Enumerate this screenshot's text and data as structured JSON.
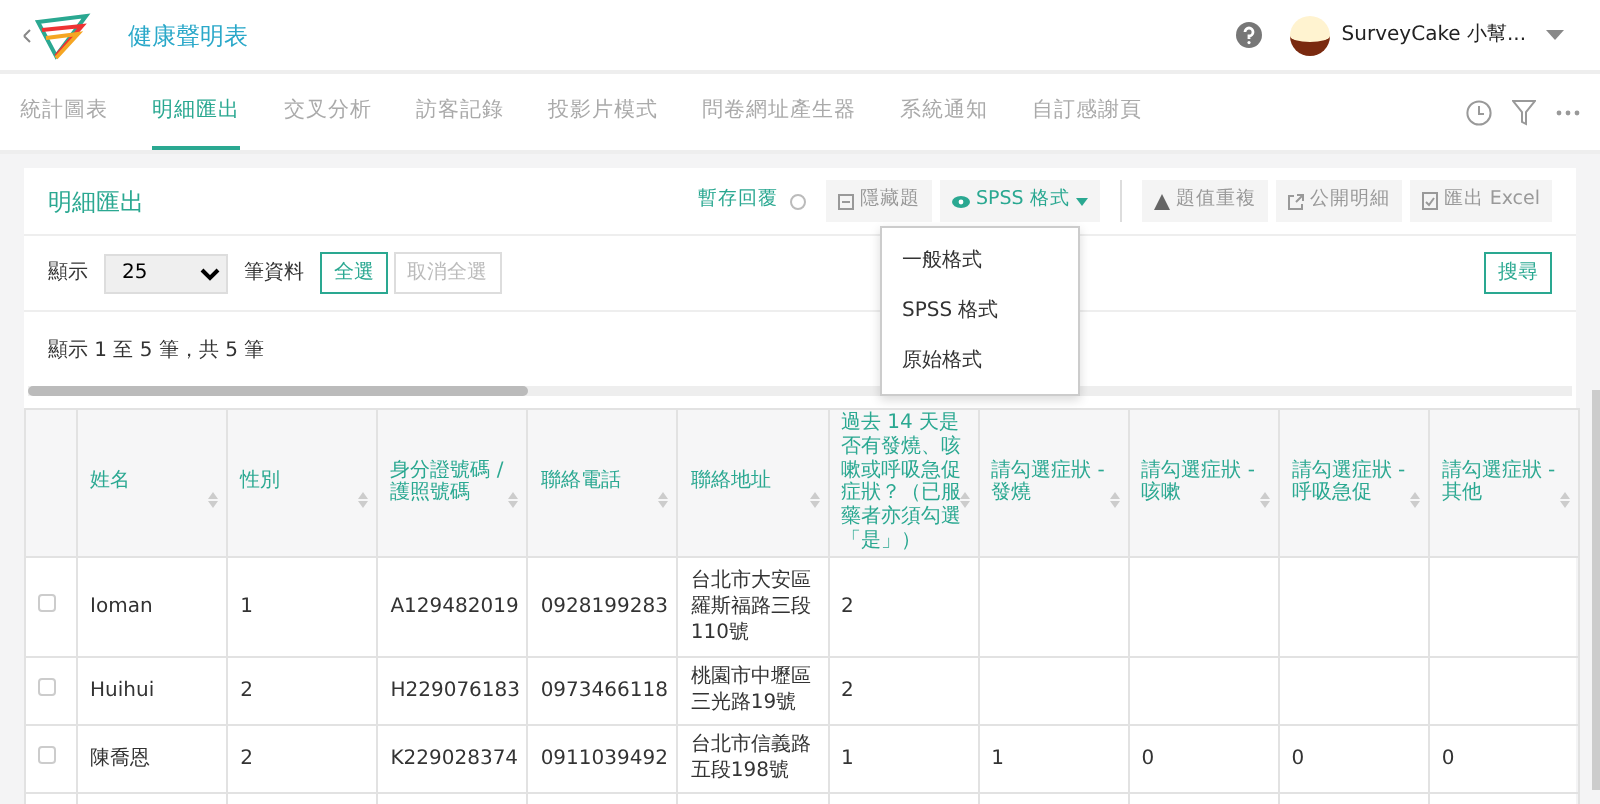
{
  "header": {
    "title": "健康聲明表",
    "user": "SurveyCake 小幫..."
  },
  "tabs": [
    {
      "label": "統計圖表",
      "selected": false
    },
    {
      "label": "明細匯出",
      "selected": true
    },
    {
      "label": "交叉分析",
      "selected": false
    },
    {
      "label": "訪客記錄",
      "selected": false
    },
    {
      "label": "投影片模式",
      "selected": false
    },
    {
      "label": "問卷網址產生器",
      "selected": false
    },
    {
      "label": "系統通知",
      "selected": false
    },
    {
      "label": "自訂感謝頁",
      "selected": false
    }
  ],
  "panel": {
    "title": "明細匯出",
    "save_draft": "暫存回覆",
    "toolbar": [
      {
        "label": "隱藏題",
        "kind": "hide",
        "expanded": false
      },
      {
        "label": "SPSS 格式",
        "kind": "format",
        "expanded": true
      },
      {
        "label": "題值重複",
        "kind": "warn",
        "expanded": false
      },
      {
        "label": "公開明細",
        "kind": "share",
        "expanded": false
      },
      {
        "label": "匯出 Excel",
        "kind": "export",
        "expanded": false
      }
    ],
    "format_menu": [
      "一般格式",
      "SPSS 格式",
      "原始格式"
    ],
    "show_label": "顯示",
    "page_size": "25",
    "page_size_suffix": "筆資料",
    "select_buttons": [
      {
        "label": "全選",
        "disabled": false
      },
      {
        "label": "取消全選",
        "disabled": true
      }
    ],
    "search_button": "搜尋",
    "info": "顯示 1 至 5 筆，共 5 筆",
    "table": {
      "columns": [
        "姓名",
        "性別",
        "身分證號碼 / 護照號碼",
        "聯絡電話",
        "聯絡地址",
        "過去 14 天是否有發燒、咳嗽或呼吸急促症狀？（已服藥者亦須勾選「是」）",
        "請勾選症狀 - 發燒",
        "請勾選症狀 - 咳嗽",
        "請勾選症狀 - 呼吸急促",
        "請勾選症狀 - 其他"
      ],
      "rows": [
        {
          "checked": false,
          "cells": [
            "Ioman",
            "1",
            "A129482019",
            "0928199283",
            "台北市大安區羅斯福路三段110號",
            "2",
            "",
            "",
            "",
            ""
          ]
        },
        {
          "checked": false,
          "cells": [
            "Huihui",
            "2",
            "H229076183",
            "0973466118",
            "桃園市中壢區三光路19號",
            "2",
            "",
            "",
            "",
            ""
          ]
        },
        {
          "checked": false,
          "cells": [
            "陳喬恩",
            "2",
            "K229028374",
            "0911039492",
            "台北市信義路五段198號",
            "1",
            "1",
            "0",
            "0",
            "0"
          ]
        }
      ]
    }
  }
}
